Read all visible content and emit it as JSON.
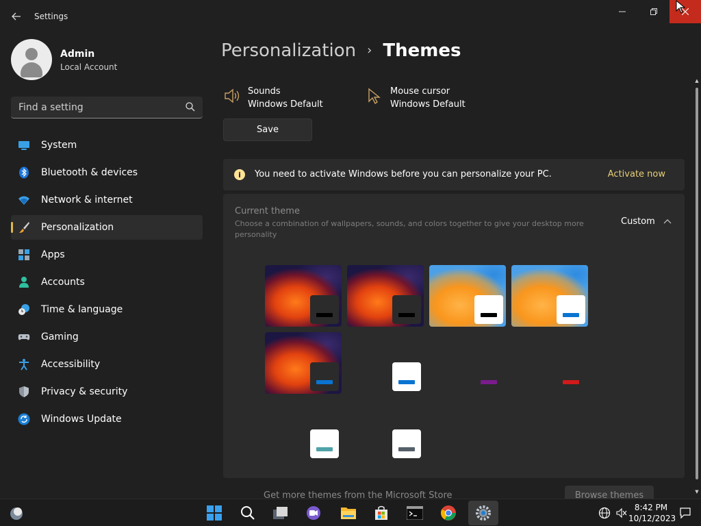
{
  "window": {
    "title": "Settings",
    "back_icon": "back-arrow-icon",
    "minimize_icon": "minimize-icon",
    "maximize_icon": "restore-icon",
    "close_icon": "close-icon"
  },
  "profile": {
    "name": "Admin",
    "account_type": "Local Account"
  },
  "search": {
    "placeholder": "Find a setting",
    "value": ""
  },
  "sidebar": {
    "items": [
      {
        "label": "System",
        "icon": "monitor-icon",
        "active": false
      },
      {
        "label": "Bluetooth & devices",
        "icon": "bluetooth-icon",
        "active": false
      },
      {
        "label": "Network & internet",
        "icon": "wifi-icon",
        "active": false
      },
      {
        "label": "Personalization",
        "icon": "paintbrush-icon",
        "active": true
      },
      {
        "label": "Apps",
        "icon": "apps-icon",
        "active": false
      },
      {
        "label": "Accounts",
        "icon": "person-icon",
        "active": false
      },
      {
        "label": "Time & language",
        "icon": "clock-globe-icon",
        "active": false
      },
      {
        "label": "Gaming",
        "icon": "gamepad-icon",
        "active": false
      },
      {
        "label": "Accessibility",
        "icon": "accessibility-icon",
        "active": false
      },
      {
        "label": "Privacy & security",
        "icon": "shield-icon",
        "active": false
      },
      {
        "label": "Windows Update",
        "icon": "update-icon",
        "active": false
      }
    ]
  },
  "breadcrumb": {
    "parent": "Personalization",
    "separator": "›",
    "current": "Themes"
  },
  "properties": {
    "sounds": {
      "title": "Sounds",
      "value": "Windows Default",
      "icon": "speaker-icon"
    },
    "cursor": {
      "title": "Mouse cursor",
      "value": "Windows Default",
      "icon": "cursor-icon"
    }
  },
  "save_label": "Save",
  "banner": {
    "icon": "info-icon",
    "glyph": "i",
    "text": "You need to activate Windows before you can personalize your PC.",
    "action": "Activate now"
  },
  "current_theme": {
    "title": "Current theme",
    "description": "Choose a combination of wallpapers, sounds, and colors together to give your desktop more personality",
    "value": "Custom",
    "expanded": true
  },
  "themes": {
    "tiles": [
      {
        "wallpaper": "dark",
        "window": "dark",
        "accent": "#000000"
      },
      {
        "wallpaper": "dark",
        "window": "dark",
        "accent": "#000000"
      },
      {
        "wallpaper": "light",
        "window": "light",
        "accent": "#000000"
      },
      {
        "wallpaper": "light",
        "window": "light",
        "accent": "#0a74d1"
      },
      {
        "wallpaper": "dark",
        "window": "dark",
        "accent": "#0a74d1"
      }
    ],
    "contrast_items": [
      {
        "style": "window",
        "accent": "#0a74d1"
      },
      {
        "style": "bar",
        "accent": "#7a1c8c"
      },
      {
        "style": "bar",
        "accent": "#d11a1a"
      },
      {
        "style": "window",
        "accent": "#4fa3a8"
      },
      {
        "style": "window",
        "accent": "#55606a"
      }
    ]
  },
  "footer": {
    "text": "Get more themes from the Microsoft Store",
    "button": "Browse themes"
  },
  "taskbar": {
    "apps": [
      "widgets-icon",
      "start-icon",
      "search-icon",
      "task-view-icon",
      "chat-icon",
      "file-explorer-icon",
      "store-icon",
      "terminal-icon",
      "chrome-icon",
      "settings-icon"
    ],
    "time": "8:42 PM",
    "date": "10/12/2023"
  },
  "colors": {
    "accent_gold": "#e0b84c",
    "link_gold": "#e7cf7a",
    "close_red": "#c42b1c",
    "background": "#202020",
    "card": "#2b2b2b"
  }
}
